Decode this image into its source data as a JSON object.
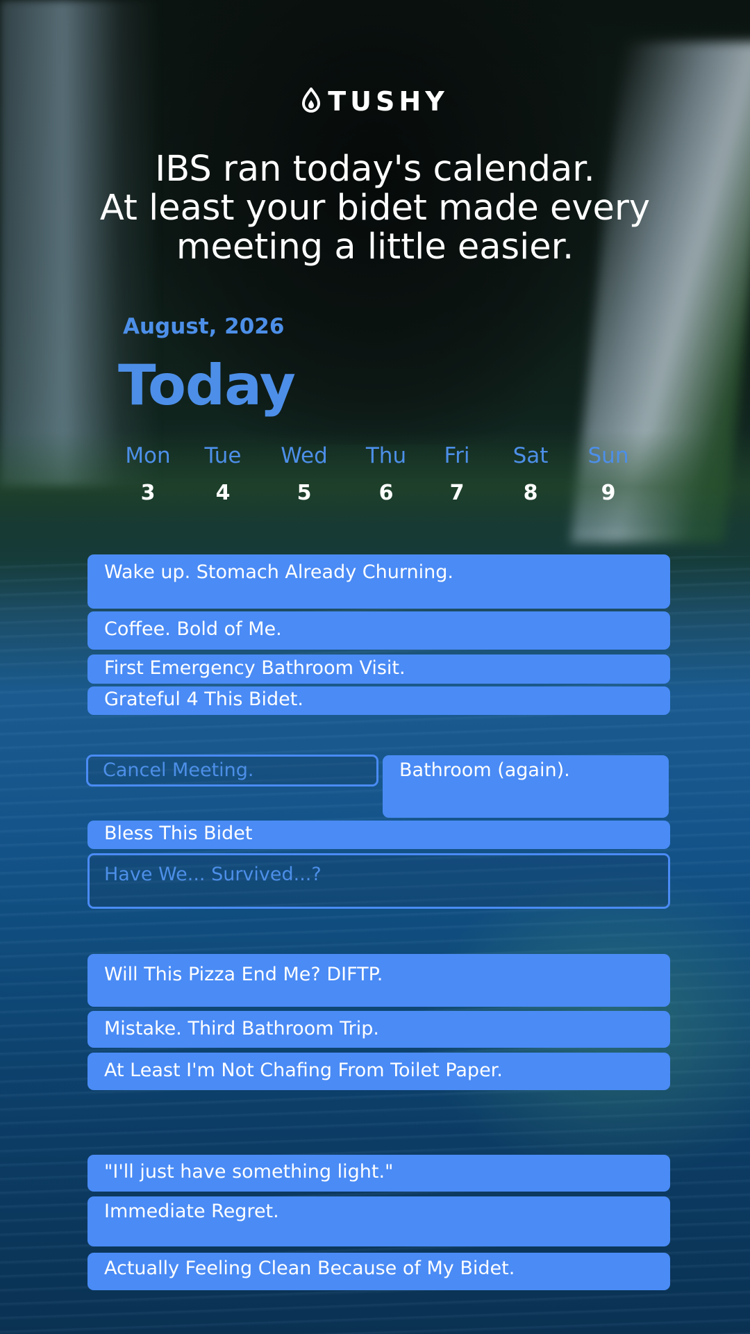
{
  "brand": {
    "name": "TUSHY",
    "icon": "droplet-flame-icon"
  },
  "headline": {
    "line1": "IBS ran today's calendar.",
    "line2": "At least your bidet made every",
    "line3": "meeting a little easier."
  },
  "calendar": {
    "month": "August, 2026",
    "title": "Today",
    "days": [
      {
        "name": "Mon",
        "num": "3"
      },
      {
        "name": "Tue",
        "num": "4"
      },
      {
        "name": "Wed",
        "num": "5"
      },
      {
        "name": "Thu",
        "num": "6"
      },
      {
        "name": "Fri",
        "num": "7"
      },
      {
        "name": "Sat",
        "num": "8"
      },
      {
        "name": "Sun",
        "num": "9"
      }
    ]
  },
  "events": [
    {
      "title": "Wake up. Stomach Already Churning.",
      "style": "filled"
    },
    {
      "title": "Coffee. Bold of Me.",
      "style": "filled"
    },
    {
      "title": "First Emergency Bathroom Visit.",
      "style": "filled"
    },
    {
      "title": "Grateful 4 This Bidet.",
      "style": "filled"
    },
    {
      "title": "Cancel Meeting.",
      "style": "outline"
    },
    {
      "title": "Bathroom (again).",
      "style": "filled"
    },
    {
      "title": "Bless This Bidet",
      "style": "filled"
    },
    {
      "title": "Have We... Survived...?",
      "style": "outline"
    },
    {
      "title": "Will This Pizza End Me? DIFTP.",
      "style": "filled"
    },
    {
      "title": "Mistake. Third Bathroom Trip.",
      "style": "filled"
    },
    {
      "title": "At Least I'm Not Chafing From Toilet Paper.",
      "style": "filled"
    },
    {
      "title": "\"I'll just have something light.\"",
      "style": "filled"
    },
    {
      "title": "Immediate Regret.",
      "style": "filled"
    },
    {
      "title": "Actually Feeling Clean Because of My Bidet.",
      "style": "filled"
    }
  ],
  "colors": {
    "accent": "#4a8bf5",
    "accent_text": "#4d8fe8",
    "text": "#ffffff"
  }
}
